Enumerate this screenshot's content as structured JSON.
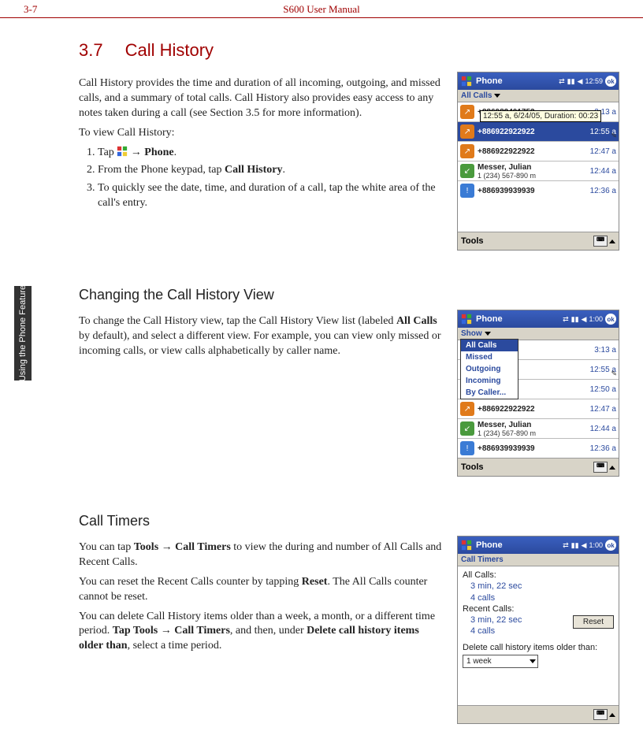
{
  "header": {
    "left": "3-7",
    "center": "S600 User Manual"
  },
  "side_tab": "Using the Phone Feature",
  "section": {
    "number": "3.7",
    "title": "Call History",
    "intro": "Call History provides the time and duration of all incoming, outgoing, and missed calls, and a summary of total calls. Call History also provides easy access to any notes taken during a call (see Section 3.5 for more information).",
    "to_view": "To view Call History:",
    "steps": {
      "s1a": "Tap ",
      "s1b": " → ",
      "s1c": "Phone",
      "s1d": ".",
      "s2a": "From the Phone keypad, tap ",
      "s2b": "Call History",
      "s2c": ".",
      "s3": "To quickly see the date, time, and duration of a call, tap the white area of the call's entry."
    }
  },
  "sub1": {
    "title": "Changing the Call History View",
    "p1a": "To change the Call History view, tap the Call History View list (labeled ",
    "p1b": "All Calls",
    "p1c": " by default), and select a different view. For example, you can view only missed or incoming calls, or view calls alphabetically by caller name."
  },
  "sub2": {
    "title": "Call Timers",
    "p1a": "You can tap ",
    "p1b": "Tools",
    "p1c": " → ",
    "p1d": "Call Timers",
    "p1e": " to view the during and number of All Calls and Recent Calls.",
    "p2a": "You can reset the Recent Calls counter by tapping ",
    "p2b": "Reset",
    "p2c": ". The All Calls counter cannot be reset.",
    "p3a": "You can delete Call History items older than a week, a month, or a different time period. ",
    "p3b": "Tap Tools",
    "p3c": " → ",
    "p3d": "Call Timers",
    "p3e": ", and then, under ",
    "p3f": "Delete call history items older than",
    "p3g": ", select a time period."
  },
  "shot1": {
    "title": "Phone",
    "clock": "12:59",
    "ok": "ok",
    "subbar": "All Calls",
    "tooltip": "12:55 a, 6/24/05, Duration: 00:23",
    "rows": [
      {
        "icon": "out",
        "name": "+886982401753",
        "sub": "",
        "time": "3:13 a"
      },
      {
        "icon": "out",
        "name": "+886922922922",
        "sub": "",
        "time": "12:55 a"
      },
      {
        "icon": "out",
        "name": "+886922922922",
        "sub": "",
        "time": "12:47 a"
      },
      {
        "icon": "in",
        "name": "Messer, Julian",
        "sub": "1 (234) 567-890 m",
        "time": "12:44 a"
      },
      {
        "icon": "miss",
        "name": "+886939939939",
        "sub": "",
        "time": "12:36 a"
      }
    ],
    "tools": "Tools"
  },
  "shot2": {
    "title": "Phone",
    "clock": "1:00",
    "ok": "ok",
    "subbar": "Show",
    "menu": [
      "All Calls",
      "Missed",
      "Outgoing",
      "Incoming",
      "By Caller..."
    ],
    "rows": [
      {
        "icon": "out",
        "name": "82401753",
        "sub": "",
        "time": "3:13 a"
      },
      {
        "icon": "out",
        "name": "22922922",
        "sub": "",
        "time": "12:55 a"
      },
      {
        "icon": "out",
        "name": "27662766",
        "sub": "",
        "time": "12:50 a"
      },
      {
        "icon": "out",
        "name": "+886922922922",
        "sub": "",
        "time": "12:47 a"
      },
      {
        "icon": "in",
        "name": "Messer, Julian",
        "sub": "1 (234) 567-890 m",
        "time": "12:44 a"
      },
      {
        "icon": "miss",
        "name": "+886939939939",
        "sub": "",
        "time": "12:36 a"
      }
    ],
    "tools": "Tools"
  },
  "shot3": {
    "title": "Phone",
    "clock": "1:00",
    "ok": "ok",
    "subbar": "Call Timers",
    "all_label": "All Calls:",
    "all_dur": "3 min, 22 sec",
    "all_ct": "4 calls",
    "rec_label": "Recent Calls:",
    "rec_dur": "3 min, 22 sec",
    "rec_ct": "4 calls",
    "reset": "Reset",
    "del_label": "Delete call history items older than:",
    "del_val": "1 week"
  }
}
